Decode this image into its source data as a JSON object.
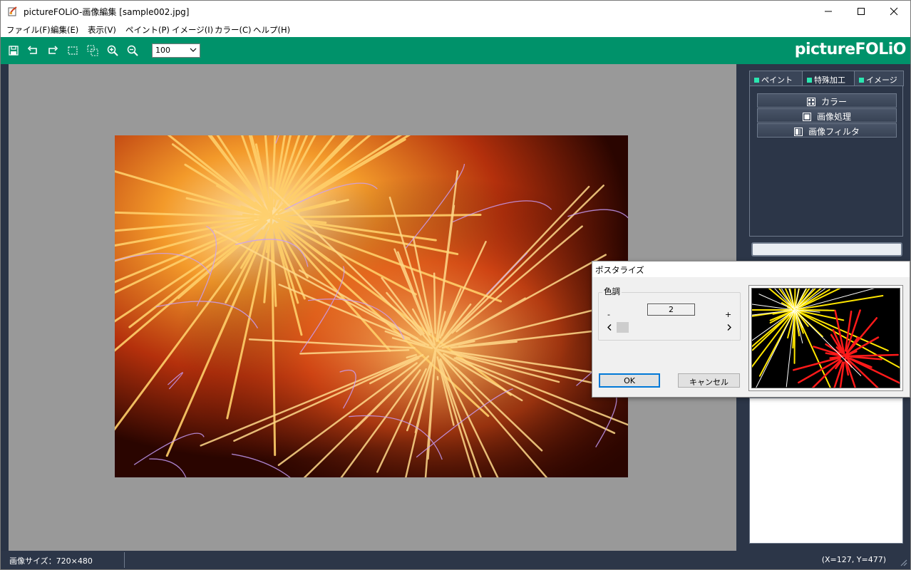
{
  "window": {
    "title": "pictureFOLiO-画像編集 [sample002.jpg]"
  },
  "menu": {
    "items": [
      "ファイル(F)",
      "編集(E)",
      "表示(V)",
      "ペイント(P)",
      "イメージ(I)",
      "カラー(C)",
      "ヘルプ(H)"
    ]
  },
  "toolbar": {
    "zoom_value": "100",
    "brand": "pictureFOLiO",
    "icons": [
      "save-icon",
      "undo-icon",
      "redo-icon",
      "select-rect-icon",
      "select-copy-icon",
      "zoom-in-icon",
      "zoom-out-icon"
    ]
  },
  "panel": {
    "tabs": [
      "ペイント",
      "特殊加工",
      "イメージ"
    ],
    "active_tab": "特殊加工",
    "buttons": [
      "カラー",
      "画像処理",
      "画像フィルタ"
    ],
    "accent": "#2be6b0"
  },
  "dialog": {
    "title": "ポスタライズ",
    "group_label": "色調",
    "minus": "-",
    "plus": "+",
    "value": "2",
    "ok_label": "OK",
    "cancel_label": "キャンセル"
  },
  "status": {
    "image_size": "画像サイズ：720×480",
    "coords": "(X=127, Y=477)"
  },
  "colors": {
    "toolbar_green": "#00926a",
    "panel_navy": "#2c3648",
    "canvas_gray": "#999999"
  }
}
